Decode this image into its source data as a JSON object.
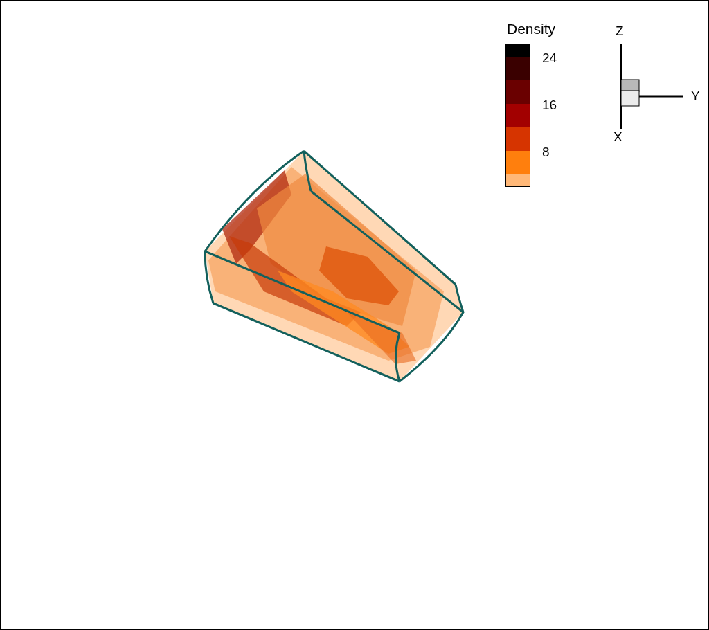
{
  "legend": {
    "title": "Density",
    "bands": [
      {
        "color": "#000000"
      },
      {
        "color": "#3a0000",
        "label": "24"
      },
      {
        "color": "#6a0000"
      },
      {
        "color": "#a20000",
        "label": "16"
      },
      {
        "color": "#d63400"
      },
      {
        "color": "#ff7f0d",
        "label": "8"
      },
      {
        "color": "#ffb878"
      }
    ]
  },
  "axes": {
    "z": "Z",
    "y": "Y",
    "x": "X"
  }
}
